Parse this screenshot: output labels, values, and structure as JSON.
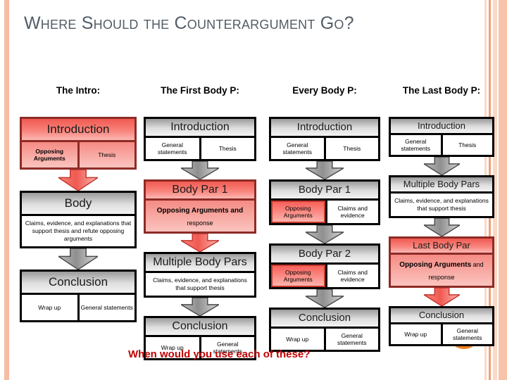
{
  "slide": {
    "title": "Where Should the Counterargument Go?",
    "footer": "When would you use each of these?",
    "accent_color": "#f58220",
    "footer_color": "#c00000",
    "title_color": "#525c66",
    "red_color": "#f8837b",
    "grey_color": "#c9c9c9"
  },
  "columns": [
    {
      "header": "The Intro:",
      "blocks": [
        {
          "band": "Introduction",
          "band_style": "red",
          "cells": [
            {
              "text": "Opposing Arguments",
              "style": "red-bold"
            },
            {
              "text": "Thesis",
              "style": "white"
            }
          ]
        },
        {
          "band": "Body",
          "band_style": "grey",
          "cells": [
            {
              "text": "Claims, evidence, and explanations that support thesis and refute opposing arguments",
              "style": "white-wide"
            }
          ]
        },
        {
          "band": "Conclusion",
          "band_style": "grey",
          "cells": [
            {
              "text": "Wrap up",
              "style": "white"
            },
            {
              "text": "General statements",
              "style": "white"
            }
          ]
        }
      ],
      "arrows": [
        "red",
        "grey"
      ]
    },
    {
      "header": "The First Body P:",
      "blocks": [
        {
          "band": "Introduction",
          "band_style": "grey",
          "cells": [
            {
              "text": "General statements",
              "style": "white"
            },
            {
              "text": "Thesis",
              "style": "white"
            }
          ]
        },
        {
          "band": "Body Par 1",
          "band_style": "red",
          "cells": [
            {
              "text_bold": "Opposing Arguments and",
              "text_normal": "response",
              "style": "red-response"
            }
          ]
        },
        {
          "band": "Multiple Body Pars",
          "band_style": "grey",
          "cells": [
            {
              "text": "Claims, evidence, and explanations that support thesis",
              "style": "white-wide"
            }
          ]
        },
        {
          "band": "Conclusion",
          "band_style": "grey",
          "cells": [
            {
              "text": "Wrap up",
              "style": "white"
            },
            {
              "text": "General statements",
              "style": "white"
            }
          ]
        }
      ],
      "arrows": [
        "grey",
        "red",
        "grey"
      ]
    },
    {
      "header": "Every Body P:",
      "blocks": [
        {
          "band": "Introduction",
          "band_style": "grey",
          "cells": [
            {
              "text": "General statements",
              "style": "white"
            },
            {
              "text": "Thesis",
              "style": "white"
            }
          ]
        },
        {
          "band": "Body Par 1",
          "band_style": "grey",
          "cells": [
            {
              "text": "Opposing Arguments",
              "style": "red-fill"
            },
            {
              "text": "Claims and evidence",
              "style": "white"
            }
          ]
        },
        {
          "band": "Body Par 2",
          "band_style": "grey",
          "cells": [
            {
              "text": "Opposing Arguments",
              "style": "red-fill"
            },
            {
              "text": "Claims and evidence",
              "style": "white"
            }
          ]
        },
        {
          "band": "Conclusion",
          "band_style": "grey",
          "cells": [
            {
              "text": "Wrap up",
              "style": "white"
            },
            {
              "text": "General statements",
              "style": "white"
            }
          ]
        }
      ],
      "arrows": [
        "grey",
        "grey",
        "grey"
      ]
    },
    {
      "header": "The Last Body P:",
      "blocks": [
        {
          "band": "Introduction",
          "band_style": "grey",
          "cells": [
            {
              "text": "General statements",
              "style": "white"
            },
            {
              "text": "Thesis",
              "style": "white"
            }
          ]
        },
        {
          "band": "Multiple Body Pars",
          "band_style": "grey",
          "cells": [
            {
              "text": "Claims, evidence, and explanations that support thesis",
              "style": "white-wide"
            }
          ]
        },
        {
          "band": "Last Body Par",
          "band_style": "red",
          "cells": [
            {
              "text_bold": "Opposing Arguments",
              "text_normal": "and response",
              "style": "red-response"
            }
          ]
        },
        {
          "band": "Conclusion",
          "band_style": "grey",
          "cells": [
            {
              "text": "Wrap up",
              "style": "white"
            },
            {
              "text": "General statements",
              "style": "white"
            }
          ]
        }
      ],
      "arrows": [
        "grey",
        "grey",
        "red"
      ]
    }
  ]
}
